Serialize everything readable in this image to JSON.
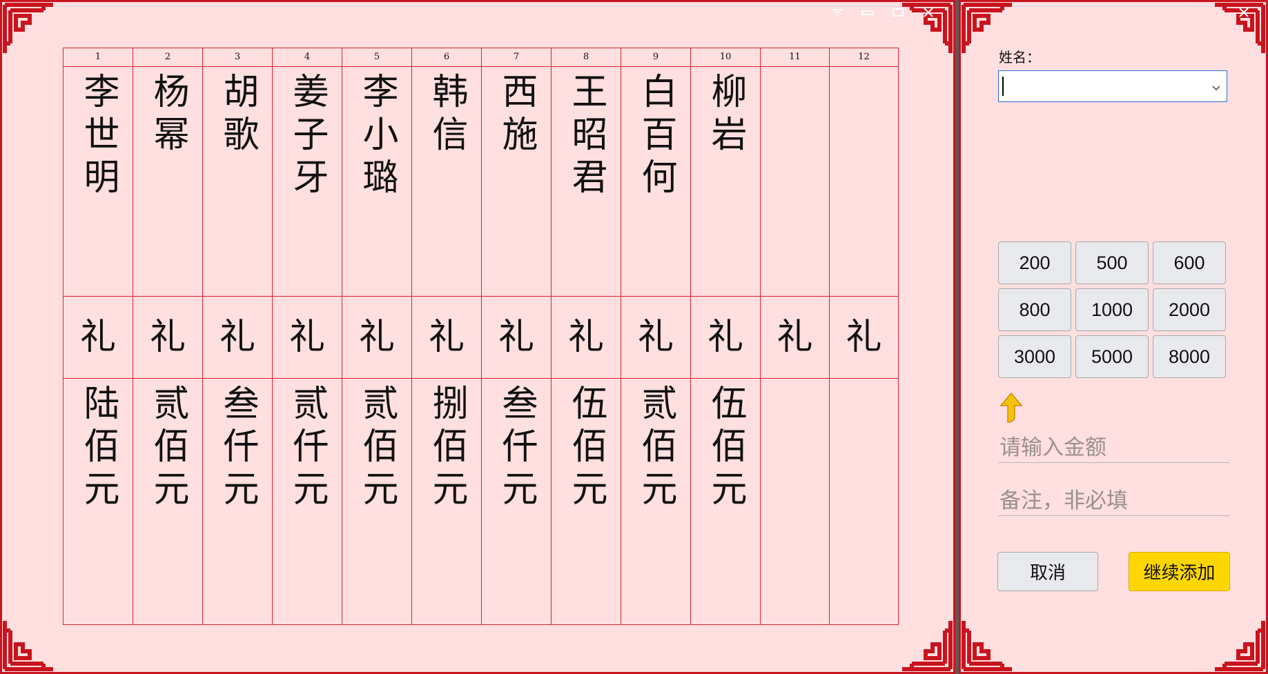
{
  "ledger": {
    "columns": [
      "1",
      "2",
      "3",
      "4",
      "5",
      "6",
      "7",
      "8",
      "9",
      "10",
      "11",
      "12"
    ],
    "names": [
      "李世明",
      "杨幂",
      "胡歌",
      "姜子牙",
      "李小璐",
      "韩信",
      "西施",
      "王昭君",
      "白百何",
      "柳岩",
      "",
      ""
    ],
    "gift": [
      "礼",
      "礼",
      "礼",
      "礼",
      "礼",
      "礼",
      "礼",
      "礼",
      "礼",
      "礼",
      "礼",
      "礼"
    ],
    "amounts": [
      "陆佰元",
      "贰佰元",
      "叁仟元",
      "贰仟元",
      "贰佰元",
      "捌佰元",
      "叁仟元",
      "伍佰元",
      "贰佰元",
      "伍佰元",
      "",
      ""
    ]
  },
  "panel": {
    "name_label": "姓名：",
    "name_value": "",
    "quick_amounts": [
      "200",
      "500",
      "600",
      "800",
      "1000",
      "2000",
      "3000",
      "5000",
      "8000"
    ],
    "amount_placeholder": "请输入金额",
    "remark_placeholder": "备注，非必填",
    "cancel_label": "取消",
    "add_label": "继续添加"
  },
  "colors": {
    "background": "#ffdfe0",
    "frame": "#c8141e",
    "grid": "#d9232d",
    "primary_button": "#ffd700"
  },
  "icons": {
    "hint": "arrow-up-icon",
    "dropdown": "chevron-down-icon"
  }
}
